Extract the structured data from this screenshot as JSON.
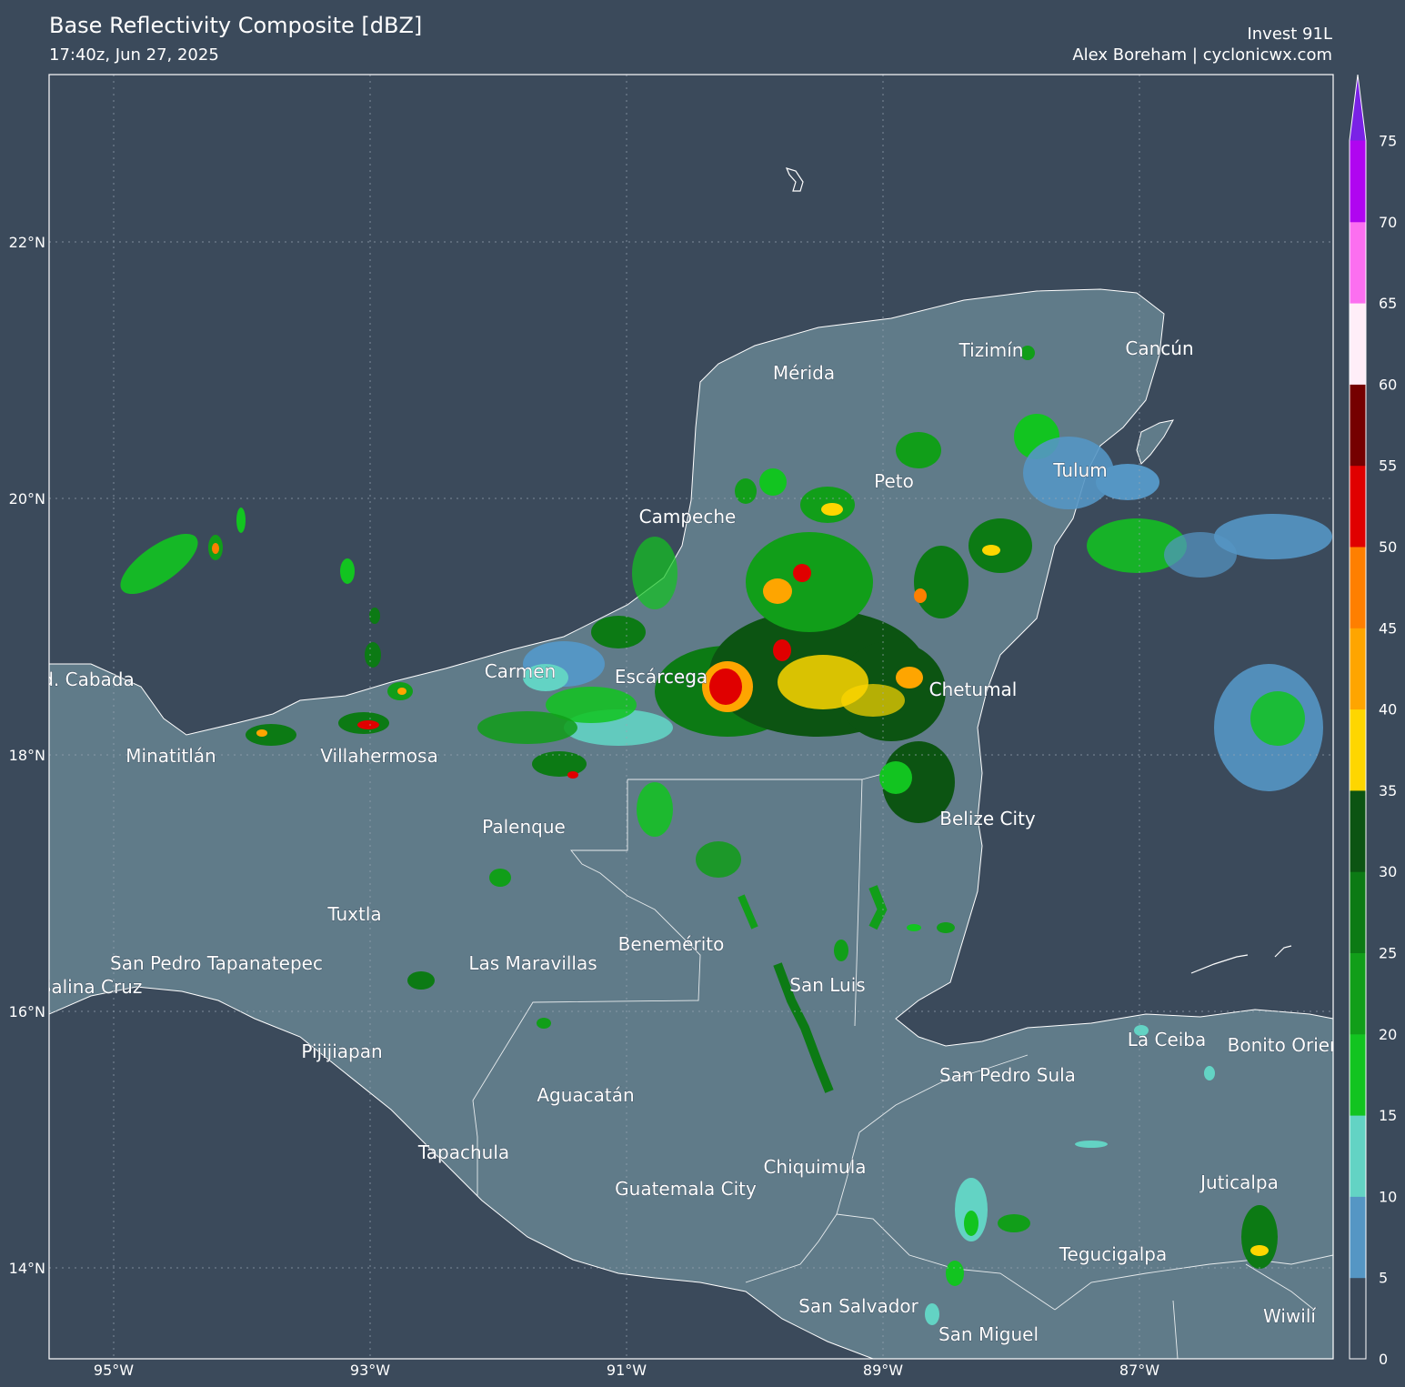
{
  "header": {
    "title": "Base Reflectivity Composite [dBZ]",
    "timestamp": "17:40z, Jun 27, 2025",
    "storm": "Invest 91L",
    "credit": "Alex Boreham | cyclonicwx.com"
  },
  "axes": {
    "lat_labels": [
      "22°N",
      "20°N",
      "18°N",
      "16°N",
      "14°N"
    ],
    "lon_labels": [
      "95°W",
      "93°W",
      "91°W",
      "89°W",
      "87°W"
    ]
  },
  "cities": [
    "Mérida",
    "Tizimín",
    "Cancún",
    "Tulum",
    "Peto",
    "Campeche",
    "Carmen",
    "Escárcega",
    "Chetumal",
    "Cd. Cabada",
    "Minatitlán",
    "Villahermosa",
    "Belize City",
    "Palenque",
    "Tuxtla",
    "Benemérito",
    "San Pedro Tapanatepec",
    "Las Maravillas",
    "Salina Cruz",
    "San Luis",
    "La Ceiba",
    "Bonito Oriental",
    "San Pedro Sula",
    "Pijijiapan",
    "Aguacatán",
    "Tapachula",
    "Chiquimula",
    "Guatemala City",
    "Juticalpa",
    "Tegucigalpa",
    "San Salvador",
    "San Miguel",
    "Wiwilí"
  ],
  "colorbar": {
    "unit": "dBZ",
    "ticks": [
      "0",
      "5",
      "10",
      "15",
      "20",
      "25",
      "30",
      "35",
      "40",
      "45",
      "50",
      "55",
      "60",
      "65",
      "70",
      "75"
    ],
    "colors": [
      "#3b4a5b",
      "#5596c4",
      "#63d3c4",
      "#12c420",
      "#119e19",
      "#0c7a14",
      "#0c5412",
      "#fed600",
      "#fea500",
      "#fe7f00",
      "#e00000",
      "#750000",
      "#ffeef8",
      "#fc6ff0",
      "#b005f0",
      "#7a22e6"
    ]
  },
  "colors": {
    "background": "#3b4a5b",
    "land": "#607b89",
    "water": "#3b4a5b",
    "border": "#ffffff"
  }
}
